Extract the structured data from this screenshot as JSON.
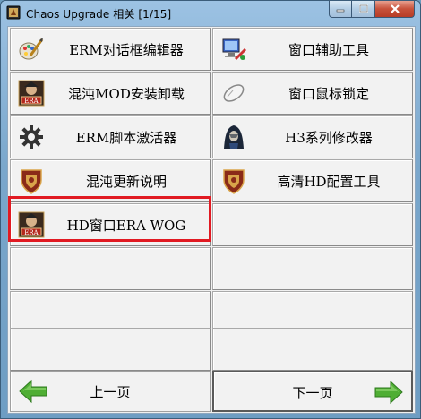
{
  "window": {
    "title": "Chaos Upgrade 相关 [1/15]"
  },
  "tools": [
    {
      "label": "ERM对话框编辑器",
      "icon": "paint-brush-icon"
    },
    {
      "label": "窗口辅助工具",
      "icon": "computer-tools-icon"
    },
    {
      "label": "混沌MOD安装卸载",
      "icon": "era-portrait-icon"
    },
    {
      "label": "窗口鼠标锁定",
      "icon": "mouse-icon"
    },
    {
      "label": "ERM脚本激活器",
      "icon": "gear-icon"
    },
    {
      "label": "H3系列修改器",
      "icon": "hooded-figure-icon"
    },
    {
      "label": "混沌更新说明",
      "icon": "shield-emblem-icon"
    },
    {
      "label": "高清HD配置工具",
      "icon": "shield-emblem-icon"
    },
    {
      "label": "HD窗口ERA WOG",
      "icon": "era-portrait-icon"
    }
  ],
  "nav": {
    "prev_label": "上一页",
    "next_label": "下一页"
  },
  "highlight_color": "#e11a22"
}
